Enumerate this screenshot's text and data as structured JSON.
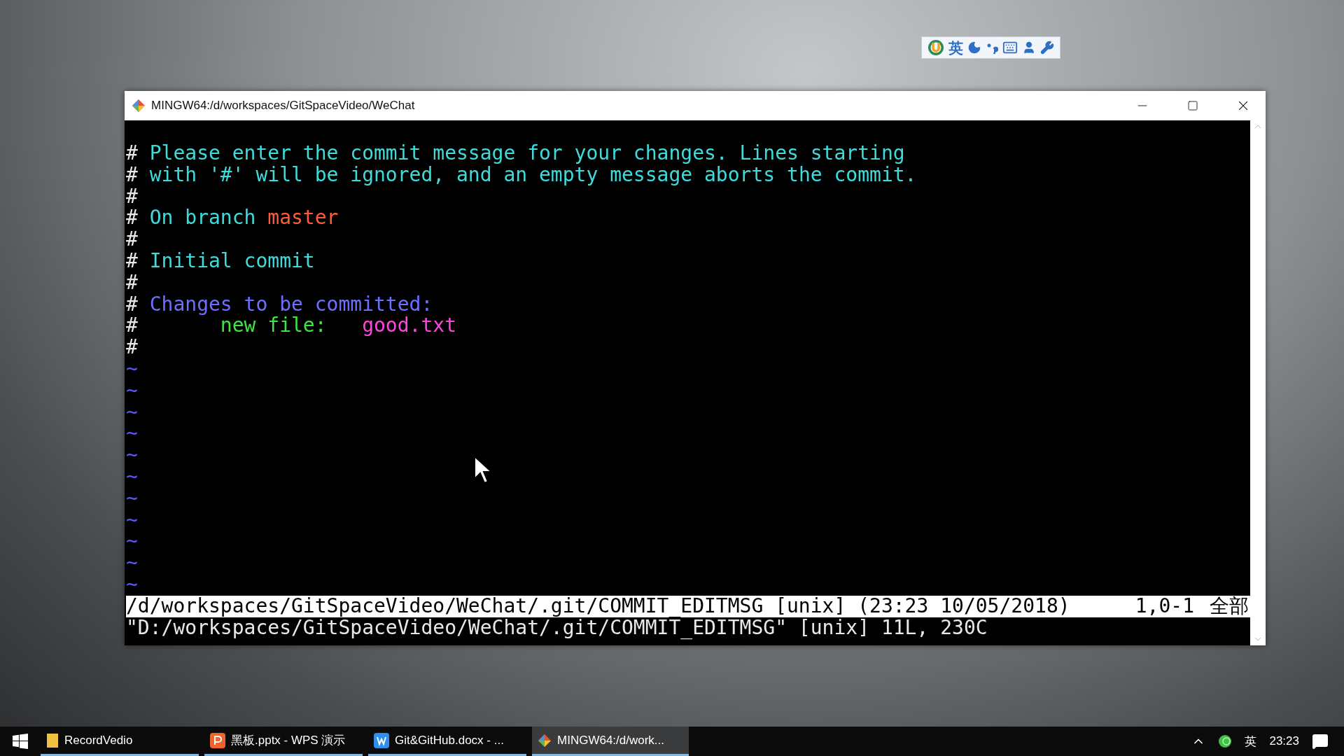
{
  "ime_toolbar": {
    "language": "英"
  },
  "window": {
    "title": "MINGW64:/d/workspaces/GitSpaceVideo/WeChat"
  },
  "editor": {
    "lines": [
      {
        "marker": "#",
        "segments": [
          {
            "kind": "comment",
            "text": " Please enter the commit message for your changes. Lines starting"
          }
        ]
      },
      {
        "marker": "#",
        "segments": [
          {
            "kind": "comment",
            "text": " with '#' will be ignored, and an empty message aborts the commit."
          }
        ]
      },
      {
        "marker": "#"
      },
      {
        "marker": "#",
        "segments": [
          {
            "kind": "comment",
            "text": " On branch "
          },
          {
            "kind": "branch",
            "text": "master"
          }
        ]
      },
      {
        "marker": "#"
      },
      {
        "marker": "#",
        "segments": [
          {
            "kind": "comment",
            "text": " Initial commit"
          }
        ]
      },
      {
        "marker": "#"
      },
      {
        "marker": "#",
        "segments": [
          {
            "kind": "heading",
            "text": " Changes to be committed:"
          }
        ]
      },
      {
        "marker": "#",
        "segments": [
          {
            "kind": "label",
            "text": "       new file:   "
          },
          {
            "kind": "filename",
            "text": "good.txt"
          }
        ]
      },
      {
        "marker": "#"
      }
    ],
    "empty_markers": [
      "~",
      "~",
      "~",
      "~",
      "~",
      "~",
      "~",
      "~",
      "~",
      "~",
      "~"
    ],
    "status_line": {
      "file": "/d/workspaces/GitSpaceVideo/WeChat/.git/COMMIT_EDITMSG [unix] (23:23 10/05/2018)",
      "position": "1,0-1",
      "scroll": "全部"
    },
    "message": "\"D:/workspaces/GitSpaceVideo/WeChat/.git/COMMIT_EDITMSG\" [unix] 11L, 230C"
  },
  "taskbar": {
    "items": [
      {
        "kind": "folder",
        "label": "RecordVedio",
        "selected": false
      },
      {
        "kind": "slides",
        "label": "黑板.pptx - WPS 演示",
        "selected": false
      },
      {
        "kind": "document",
        "label": "Git&GitHub.docx - ...",
        "selected": false
      },
      {
        "kind": "terminal",
        "label": "MINGW64:/d/work...",
        "selected": true
      }
    ],
    "tray": {
      "input_language": "英",
      "time": "23:23"
    }
  }
}
